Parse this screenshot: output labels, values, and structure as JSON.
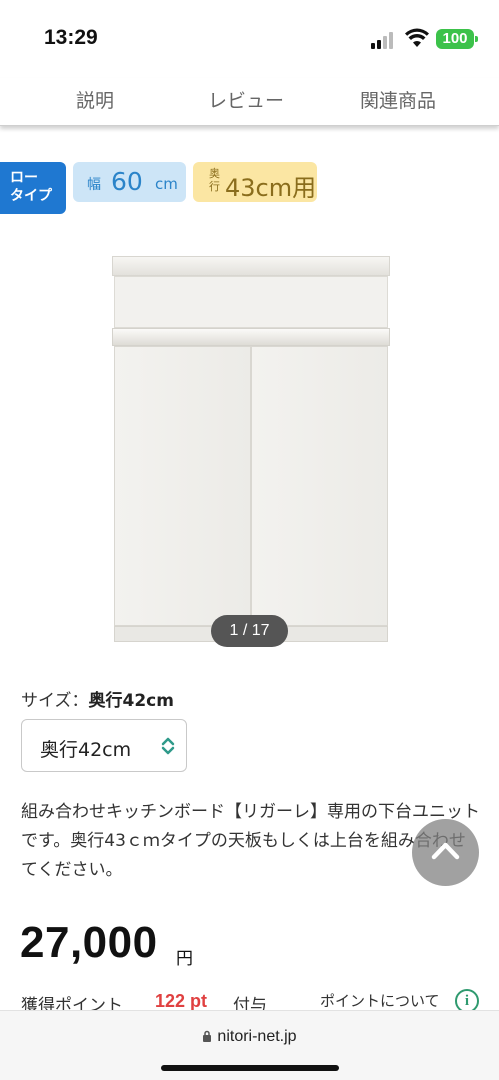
{
  "status_bar": {
    "time": "13:29",
    "battery": "100",
    "icons": [
      "signal-icon",
      "wifi-icon",
      "battery-icon"
    ]
  },
  "tabs": [
    {
      "label": "説明"
    },
    {
      "label": "レビュー"
    },
    {
      "label": "関連商品"
    }
  ],
  "badges": {
    "low_type": {
      "line1": "ロー",
      "line2": "タイプ"
    },
    "width": {
      "prefix": "幅",
      "value": "60",
      "unit": "cm"
    },
    "depth": {
      "prefix": "奥行",
      "value": "43cm用"
    }
  },
  "gallery": {
    "counter": "1 / 17"
  },
  "size": {
    "label": "サイズ：",
    "selected": "奥行42cm",
    "select_value": "奥行42cm"
  },
  "description": "組み合わせキッチンボード【リガーレ】専用の下台ユニットです。奥行43ｃｍタイプの天板もしくは上台を組み合わせてください。",
  "price": {
    "amount": "27,000",
    "unit": "円"
  },
  "points": {
    "label": "獲得ポイント",
    "value": "122 pt",
    "suffix": "付与",
    "about_link": "ポイントについて"
  },
  "browser": {
    "url": "nitori-net.jp"
  },
  "colors": {
    "accent_blue": "#1f78d1",
    "width_badge_bg": "#cde5f7",
    "depth_badge_bg": "#fbe6a3",
    "points_red": "#e04040",
    "info_green": "#2f9a6f",
    "battery_green": "#3cc24a"
  }
}
